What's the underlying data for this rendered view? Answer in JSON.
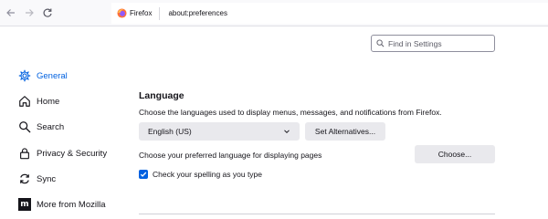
{
  "toolbar": {
    "identity_label": "Firefox",
    "url": "about:preferences"
  },
  "search": {
    "placeholder": "Find in Settings"
  },
  "sidebar": {
    "items": [
      {
        "label": "General",
        "icon": "gear-icon",
        "selected": true
      },
      {
        "label": "Home",
        "icon": "home-icon"
      },
      {
        "label": "Search",
        "icon": "search-icon"
      },
      {
        "label": "Privacy & Security",
        "icon": "lock-icon"
      },
      {
        "label": "Sync",
        "icon": "sync-icon"
      },
      {
        "label": "More from Mozilla",
        "icon": "mozilla-icon"
      }
    ]
  },
  "language": {
    "title": "Language",
    "description": "Choose the languages used to display menus, messages, and notifications from Firefox.",
    "selected_language": "English (US)",
    "set_alternatives_label": "Set Alternatives...",
    "preferred_text": "Choose your preferred language for displaying pages",
    "choose_label": "Choose...",
    "spellcheck_label": "Check your spelling as you type",
    "spellcheck_checked": true
  },
  "colors": {
    "accent": "#0061e0",
    "button_bg": "#e9e9ed"
  }
}
